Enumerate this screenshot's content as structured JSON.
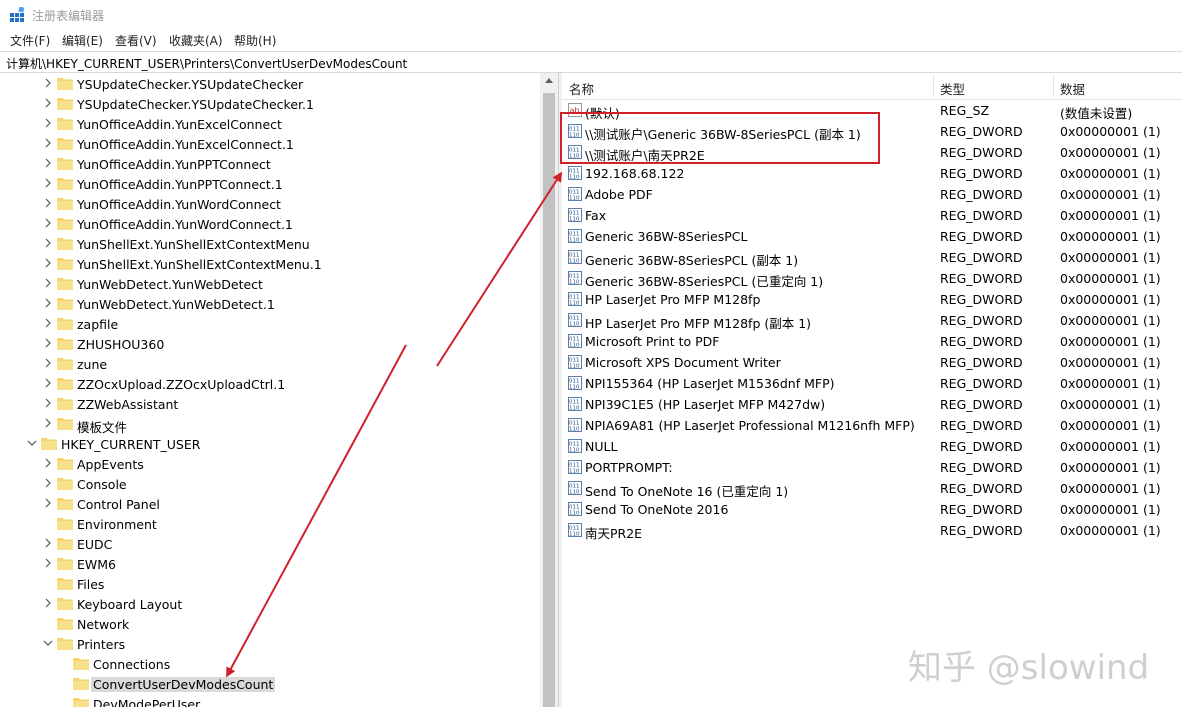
{
  "window": {
    "title": "注册表编辑器"
  },
  "menu": [
    "文件(F)",
    "编辑(E)",
    "查看(V)",
    "收藏夹(A)",
    "帮助(H)"
  ],
  "address": "计算机\\HKEY_CURRENT_USER\\Printers\\ConvertUserDevModesCount",
  "tree": [
    {
      "label": "YSUpdateChecker.YSUpdateChecker",
      "level": 2
    },
    {
      "label": "YSUpdateChecker.YSUpdateChecker.1",
      "level": 2
    },
    {
      "label": "YunOfficeAddin.YunExcelConnect",
      "level": 2
    },
    {
      "label": "YunOfficeAddin.YunExcelConnect.1",
      "level": 2
    },
    {
      "label": "YunOfficeAddin.YunPPTConnect",
      "level": 2
    },
    {
      "label": "YunOfficeAddin.YunPPTConnect.1",
      "level": 2
    },
    {
      "label": "YunOfficeAddin.YunWordConnect",
      "level": 2
    },
    {
      "label": "YunOfficeAddin.YunWordConnect.1",
      "level": 2
    },
    {
      "label": "YunShellExt.YunShellExtContextMenu",
      "level": 2
    },
    {
      "label": "YunShellExt.YunShellExtContextMenu.1",
      "level": 2
    },
    {
      "label": "YunWebDetect.YunWebDetect",
      "level": 2
    },
    {
      "label": "YunWebDetect.YunWebDetect.1",
      "level": 2
    },
    {
      "label": "zapfile",
      "level": 2
    },
    {
      "label": "ZHUSHOU360",
      "level": 2
    },
    {
      "label": "zune",
      "level": 2
    },
    {
      "label": "ZZOcxUpload.ZZOcxUploadCtrl.1",
      "level": 2
    },
    {
      "label": "ZZWebAssistant",
      "level": 2
    },
    {
      "label": "模板文件",
      "level": 2
    },
    {
      "label": "HKEY_CURRENT_USER",
      "level": 1,
      "expanded": true
    },
    {
      "label": "AppEvents",
      "level": 2
    },
    {
      "label": "Console",
      "level": 2
    },
    {
      "label": "Control Panel",
      "level": 2
    },
    {
      "label": "Environment",
      "level": 2,
      "leaf": true
    },
    {
      "label": "EUDC",
      "level": 2
    },
    {
      "label": "EWM6",
      "level": 2
    },
    {
      "label": "Files",
      "level": 2,
      "leaf": true
    },
    {
      "label": "Keyboard Layout",
      "level": 2
    },
    {
      "label": "Network",
      "level": 2,
      "leaf": true
    },
    {
      "label": "Printers",
      "level": 2,
      "expanded": true
    },
    {
      "label": "Connections",
      "level": 3,
      "leaf": true
    },
    {
      "label": "ConvertUserDevModesCount",
      "level": 3,
      "leaf": true,
      "selected": true
    },
    {
      "label": "DevModePerUser",
      "level": 3,
      "leaf": true
    }
  ],
  "columns": {
    "name": "名称",
    "type": "类型",
    "data": "数据"
  },
  "values": [
    {
      "name": "(默认)",
      "type": "REG_SZ",
      "data": "(数值未设置)",
      "icon": "string-value-icon"
    },
    {
      "name": "\\\\测试账户\\Generic 36BW-8SeriesPCL (副本 1)",
      "type": "REG_DWORD",
      "data": "0x00000001 (1)",
      "icon": "dword-value-icon"
    },
    {
      "name": "\\\\测试账户\\南天PR2E",
      "type": "REG_DWORD",
      "data": "0x00000001 (1)",
      "icon": "dword-value-icon"
    },
    {
      "name": "192.168.68.122",
      "type": "REG_DWORD",
      "data": "0x00000001 (1)",
      "icon": "dword-value-icon"
    },
    {
      "name": "Adobe PDF",
      "type": "REG_DWORD",
      "data": "0x00000001 (1)",
      "icon": "dword-value-icon"
    },
    {
      "name": "Fax",
      "type": "REG_DWORD",
      "data": "0x00000001 (1)",
      "icon": "dword-value-icon"
    },
    {
      "name": "Generic 36BW-8SeriesPCL",
      "type": "REG_DWORD",
      "data": "0x00000001 (1)",
      "icon": "dword-value-icon"
    },
    {
      "name": "Generic 36BW-8SeriesPCL (副本 1)",
      "type": "REG_DWORD",
      "data": "0x00000001 (1)",
      "icon": "dword-value-icon"
    },
    {
      "name": "Generic 36BW-8SeriesPCL (已重定向 1)",
      "type": "REG_DWORD",
      "data": "0x00000001 (1)",
      "icon": "dword-value-icon"
    },
    {
      "name": "HP LaserJet Pro MFP M128fp",
      "type": "REG_DWORD",
      "data": "0x00000001 (1)",
      "icon": "dword-value-icon"
    },
    {
      "name": "HP LaserJet Pro MFP M128fp (副本 1)",
      "type": "REG_DWORD",
      "data": "0x00000001 (1)",
      "icon": "dword-value-icon"
    },
    {
      "name": "Microsoft Print to PDF",
      "type": "REG_DWORD",
      "data": "0x00000001 (1)",
      "icon": "dword-value-icon"
    },
    {
      "name": "Microsoft XPS Document Writer",
      "type": "REG_DWORD",
      "data": "0x00000001 (1)",
      "icon": "dword-value-icon"
    },
    {
      "name": "NPI155364 (HP LaserJet M1536dnf MFP)",
      "type": "REG_DWORD",
      "data": "0x00000001 (1)",
      "icon": "dword-value-icon"
    },
    {
      "name": "NPI39C1E5 (HP LaserJet MFP M427dw)",
      "type": "REG_DWORD",
      "data": "0x00000001 (1)",
      "icon": "dword-value-icon"
    },
    {
      "name": "NPIA69A81 (HP LaserJet Professional M1216nfh MFP)",
      "type": "REG_DWORD",
      "data": "0x00000001 (1)",
      "icon": "dword-value-icon"
    },
    {
      "name": "NULL",
      "type": "REG_DWORD",
      "data": "0x00000001 (1)",
      "icon": "dword-value-icon"
    },
    {
      "name": "PORTPROMPT:",
      "type": "REG_DWORD",
      "data": "0x00000001 (1)",
      "icon": "dword-value-icon"
    },
    {
      "name": "Send To OneNote 16 (已重定向 1)",
      "type": "REG_DWORD",
      "data": "0x00000001 (1)",
      "icon": "dword-value-icon"
    },
    {
      "name": "Send To OneNote 2016",
      "type": "REG_DWORD",
      "data": "0x00000001 (1)",
      "icon": "dword-value-icon"
    },
    {
      "name": "南天PR2E",
      "type": "REG_DWORD",
      "data": "0x00000001 (1)",
      "icon": "dword-value-icon"
    }
  ],
  "annotation_color": "#d0202a",
  "watermark": "知乎 @slowind"
}
